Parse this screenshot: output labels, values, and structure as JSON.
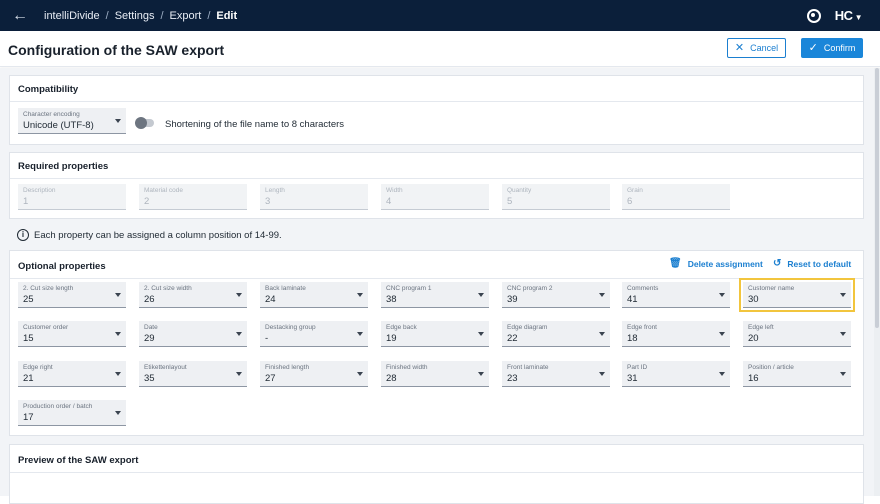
{
  "topbar": {
    "back_icon": "arrow-left-icon",
    "breadcrumb": [
      "intelliDivide",
      "Settings",
      "Export",
      "Edit"
    ],
    "user_icon": "user-support-icon",
    "logo": "HC"
  },
  "header": {
    "title": "Configuration of the SAW export",
    "cancel_label": "Cancel",
    "confirm_label": "Confirm"
  },
  "compatibility": {
    "title": "Compatibility",
    "encoding": {
      "label": "Character encoding",
      "value": "Unicode (UTF-8)"
    },
    "toggle_label": "Shortening of the file name to 8 characters",
    "toggle_on": false
  },
  "required": {
    "title": "Required properties",
    "fields": [
      {
        "label": "Description",
        "value": "1"
      },
      {
        "label": "Material code",
        "value": "2"
      },
      {
        "label": "Length",
        "value": "3"
      },
      {
        "label": "Width",
        "value": "4"
      },
      {
        "label": "Quantity",
        "value": "5"
      },
      {
        "label": "Grain",
        "value": "6"
      }
    ]
  },
  "info_text": "Each property can be assigned a column position of 14-99.",
  "optional": {
    "title": "Optional properties",
    "delete_label": "Delete assignment",
    "reset_label": "Reset to default",
    "fields": [
      {
        "label": "2. Cut size length",
        "value": "25"
      },
      {
        "label": "2. Cut size width",
        "value": "26"
      },
      {
        "label": "Back laminate",
        "value": "24"
      },
      {
        "label": "CNC program 1",
        "value": "38"
      },
      {
        "label": "CNC program 2",
        "value": "39"
      },
      {
        "label": "Comments",
        "value": "41"
      },
      {
        "label": "Customer name",
        "value": "30"
      },
      {
        "label": "Customer order",
        "value": "15"
      },
      {
        "label": "Date",
        "value": "29"
      },
      {
        "label": "Destacking group",
        "value": "-"
      },
      {
        "label": "Edge back",
        "value": "19"
      },
      {
        "label": "Edge diagram",
        "value": "22"
      },
      {
        "label": "Edge front",
        "value": "18"
      },
      {
        "label": "Edge left",
        "value": "20"
      },
      {
        "label": "Edge right",
        "value": "21"
      },
      {
        "label": "Etikettenlayout",
        "value": "35"
      },
      {
        "label": "Finished length",
        "value": "27"
      },
      {
        "label": "Finished width",
        "value": "28"
      },
      {
        "label": "Front laminate",
        "value": "23"
      },
      {
        "label": "Part ID",
        "value": "31"
      },
      {
        "label": "Position / article",
        "value": "16"
      },
      {
        "label": "Production order / batch",
        "value": "17"
      }
    ]
  },
  "preview": {
    "title": "Preview of the SAW export"
  },
  "colors": {
    "topbar": "#0b1f3a",
    "accent": "#1a86d9",
    "highlight": "#f2c53d"
  }
}
